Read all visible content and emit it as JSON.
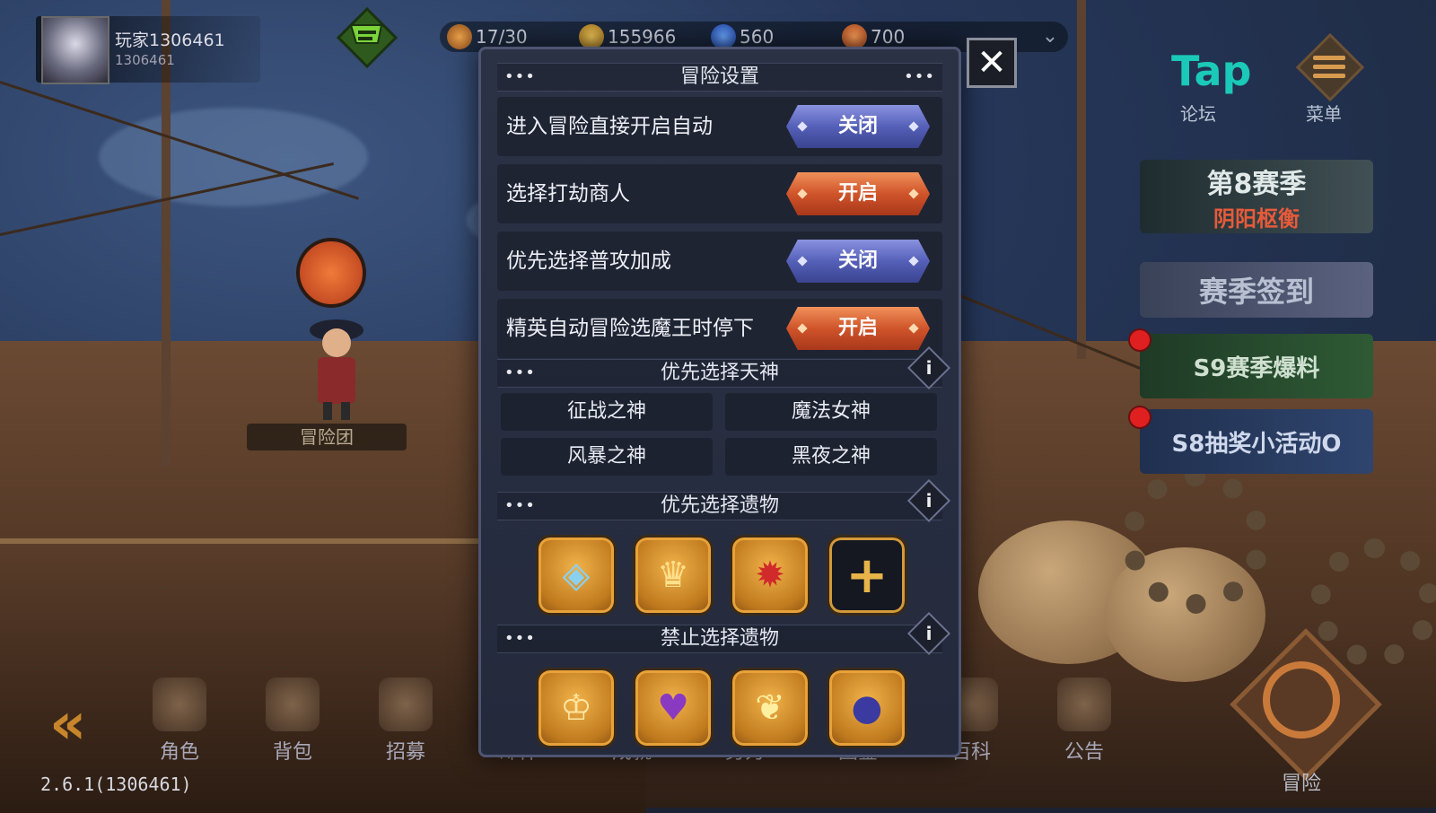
{
  "hud": {
    "player_name": "玩家1306461",
    "player_id": "1306461",
    "resources": [
      {
        "icon": "bread-stamina-icon",
        "value": "17/30",
        "color": "#d08a3a"
      },
      {
        "icon": "gold-coin-icon",
        "value": "155966",
        "color": "#d9a83a"
      },
      {
        "icon": "blue-gem-icon",
        "value": "560",
        "color": "#3a7ad9"
      },
      {
        "icon": "orange-gem-icon",
        "value": "700",
        "color": "#e07a2a"
      }
    ]
  },
  "side_buttons": {
    "forum": {
      "logo": "Tap",
      "label": "论坛"
    },
    "menu": {
      "label": "菜单"
    }
  },
  "promos": {
    "season_title": "第8赛季",
    "season_subtitle": "阴阳枢衡",
    "season_sign": "赛季签到",
    "s9": "S9赛季爆料",
    "s8": "S8抽奖小活动O"
  },
  "team_label": "冒险团",
  "modal": {
    "title": "冒险设置",
    "settings": [
      {
        "label": "进入冒险直接开启自动",
        "state": "关闭"
      },
      {
        "label": "选择打劫商人",
        "state": "开启"
      },
      {
        "label": "优先选择普攻加成",
        "state": "关闭"
      },
      {
        "label": "精英自动冒险选魔王时停下",
        "state": "开启"
      }
    ],
    "gods_title": "优先选择天神",
    "gods": [
      "征战之神",
      "魔法女神",
      "风暴之神",
      "黑夜之神"
    ],
    "preferred_relics_title": "优先选择遗物",
    "preferred_relics": [
      "shield-rune-icon",
      "gold-cards-icon",
      "demon-emblem-icon"
    ],
    "forbidden_relics_title": "禁止选择遗物",
    "forbidden_relics": [
      "crown-icon",
      "heart-icon",
      "golden-branch-icon",
      "bomb-icon"
    ]
  },
  "bottom_nav": [
    {
      "label": "角色",
      "icon": "helmet-icon"
    },
    {
      "label": "背包",
      "icon": "backpack-icon"
    },
    {
      "label": "招募",
      "icon": "wings-icon"
    },
    {
      "label": "邮件",
      "icon": "mail-icon"
    },
    {
      "label": "成就",
      "icon": "trophy-icon"
    },
    {
      "label": "势力",
      "icon": "banner-icon"
    },
    {
      "label": "图鉴",
      "icon": "book-icon"
    },
    {
      "label": "百科",
      "icon": "open-book-icon"
    },
    {
      "label": "公告",
      "icon": "flag-icon"
    }
  ],
  "adventure_label": "冒险",
  "version": "2.6.1(1306461)",
  "colors": {
    "toggle_off": "#5560b8",
    "toggle_on": "#d0542a",
    "relic_gold": "#c07a1e"
  }
}
